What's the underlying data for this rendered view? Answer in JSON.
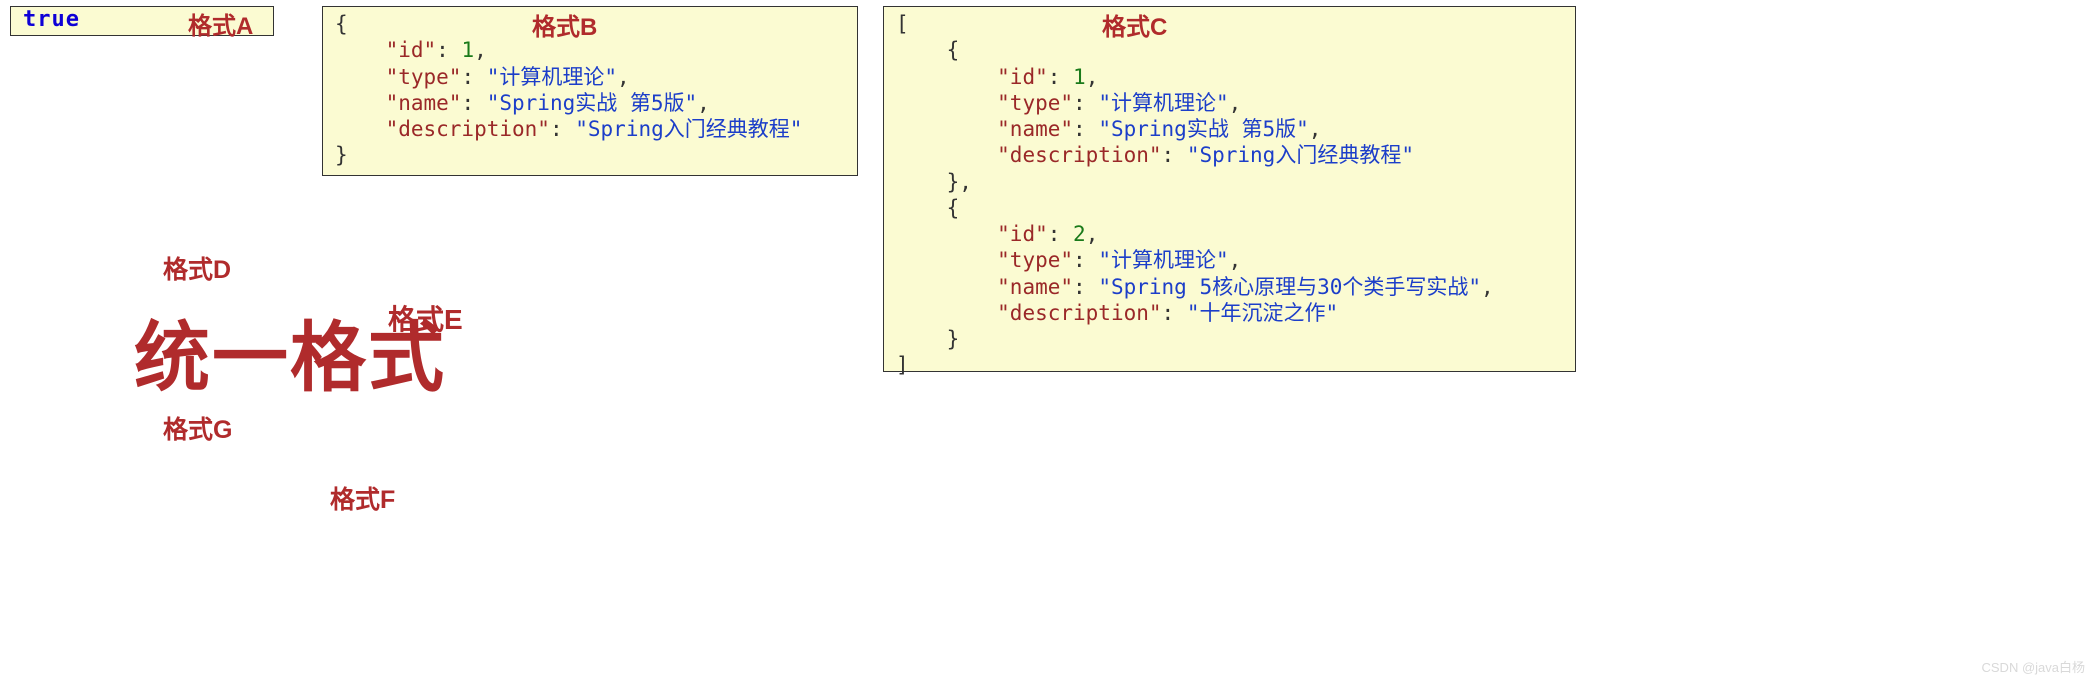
{
  "boxA": {
    "value": "true",
    "label": "格式A"
  },
  "boxB": {
    "label": "格式B",
    "obj": {
      "keys": {
        "id": "\"id\"",
        "type": "\"type\"",
        "name": "\"name\"",
        "description": "\"description\""
      },
      "vals": {
        "id": "1",
        "type": "\"计算机理论\"",
        "name": "\"Spring实战 第5版\"",
        "description": "\"Spring入门经典教程\""
      }
    }
  },
  "boxC": {
    "label": "格式C",
    "items": [
      {
        "keys": {
          "id": "\"id\"",
          "type": "\"type\"",
          "name": "\"name\"",
          "description": "\"description\""
        },
        "vals": {
          "id": "1",
          "type": "\"计算机理论\"",
          "name": "\"Spring实战 第5版\"",
          "description": "\"Spring入门经典教程\""
        }
      },
      {
        "keys": {
          "id": "\"id\"",
          "type": "\"type\"",
          "name": "\"name\"",
          "description": "\"description\""
        },
        "vals": {
          "id": "2",
          "type": "\"计算机理论\"",
          "name": "\"Spring 5核心原理与30个类手写实战\"",
          "description": "\"十年沉淀之作\""
        }
      }
    ]
  },
  "labels": {
    "d": "格式D",
    "e": "格式E",
    "f": "格式F",
    "g": "格式G",
    "unified": "统一格式"
  },
  "watermark": "CSDN @java白杨"
}
